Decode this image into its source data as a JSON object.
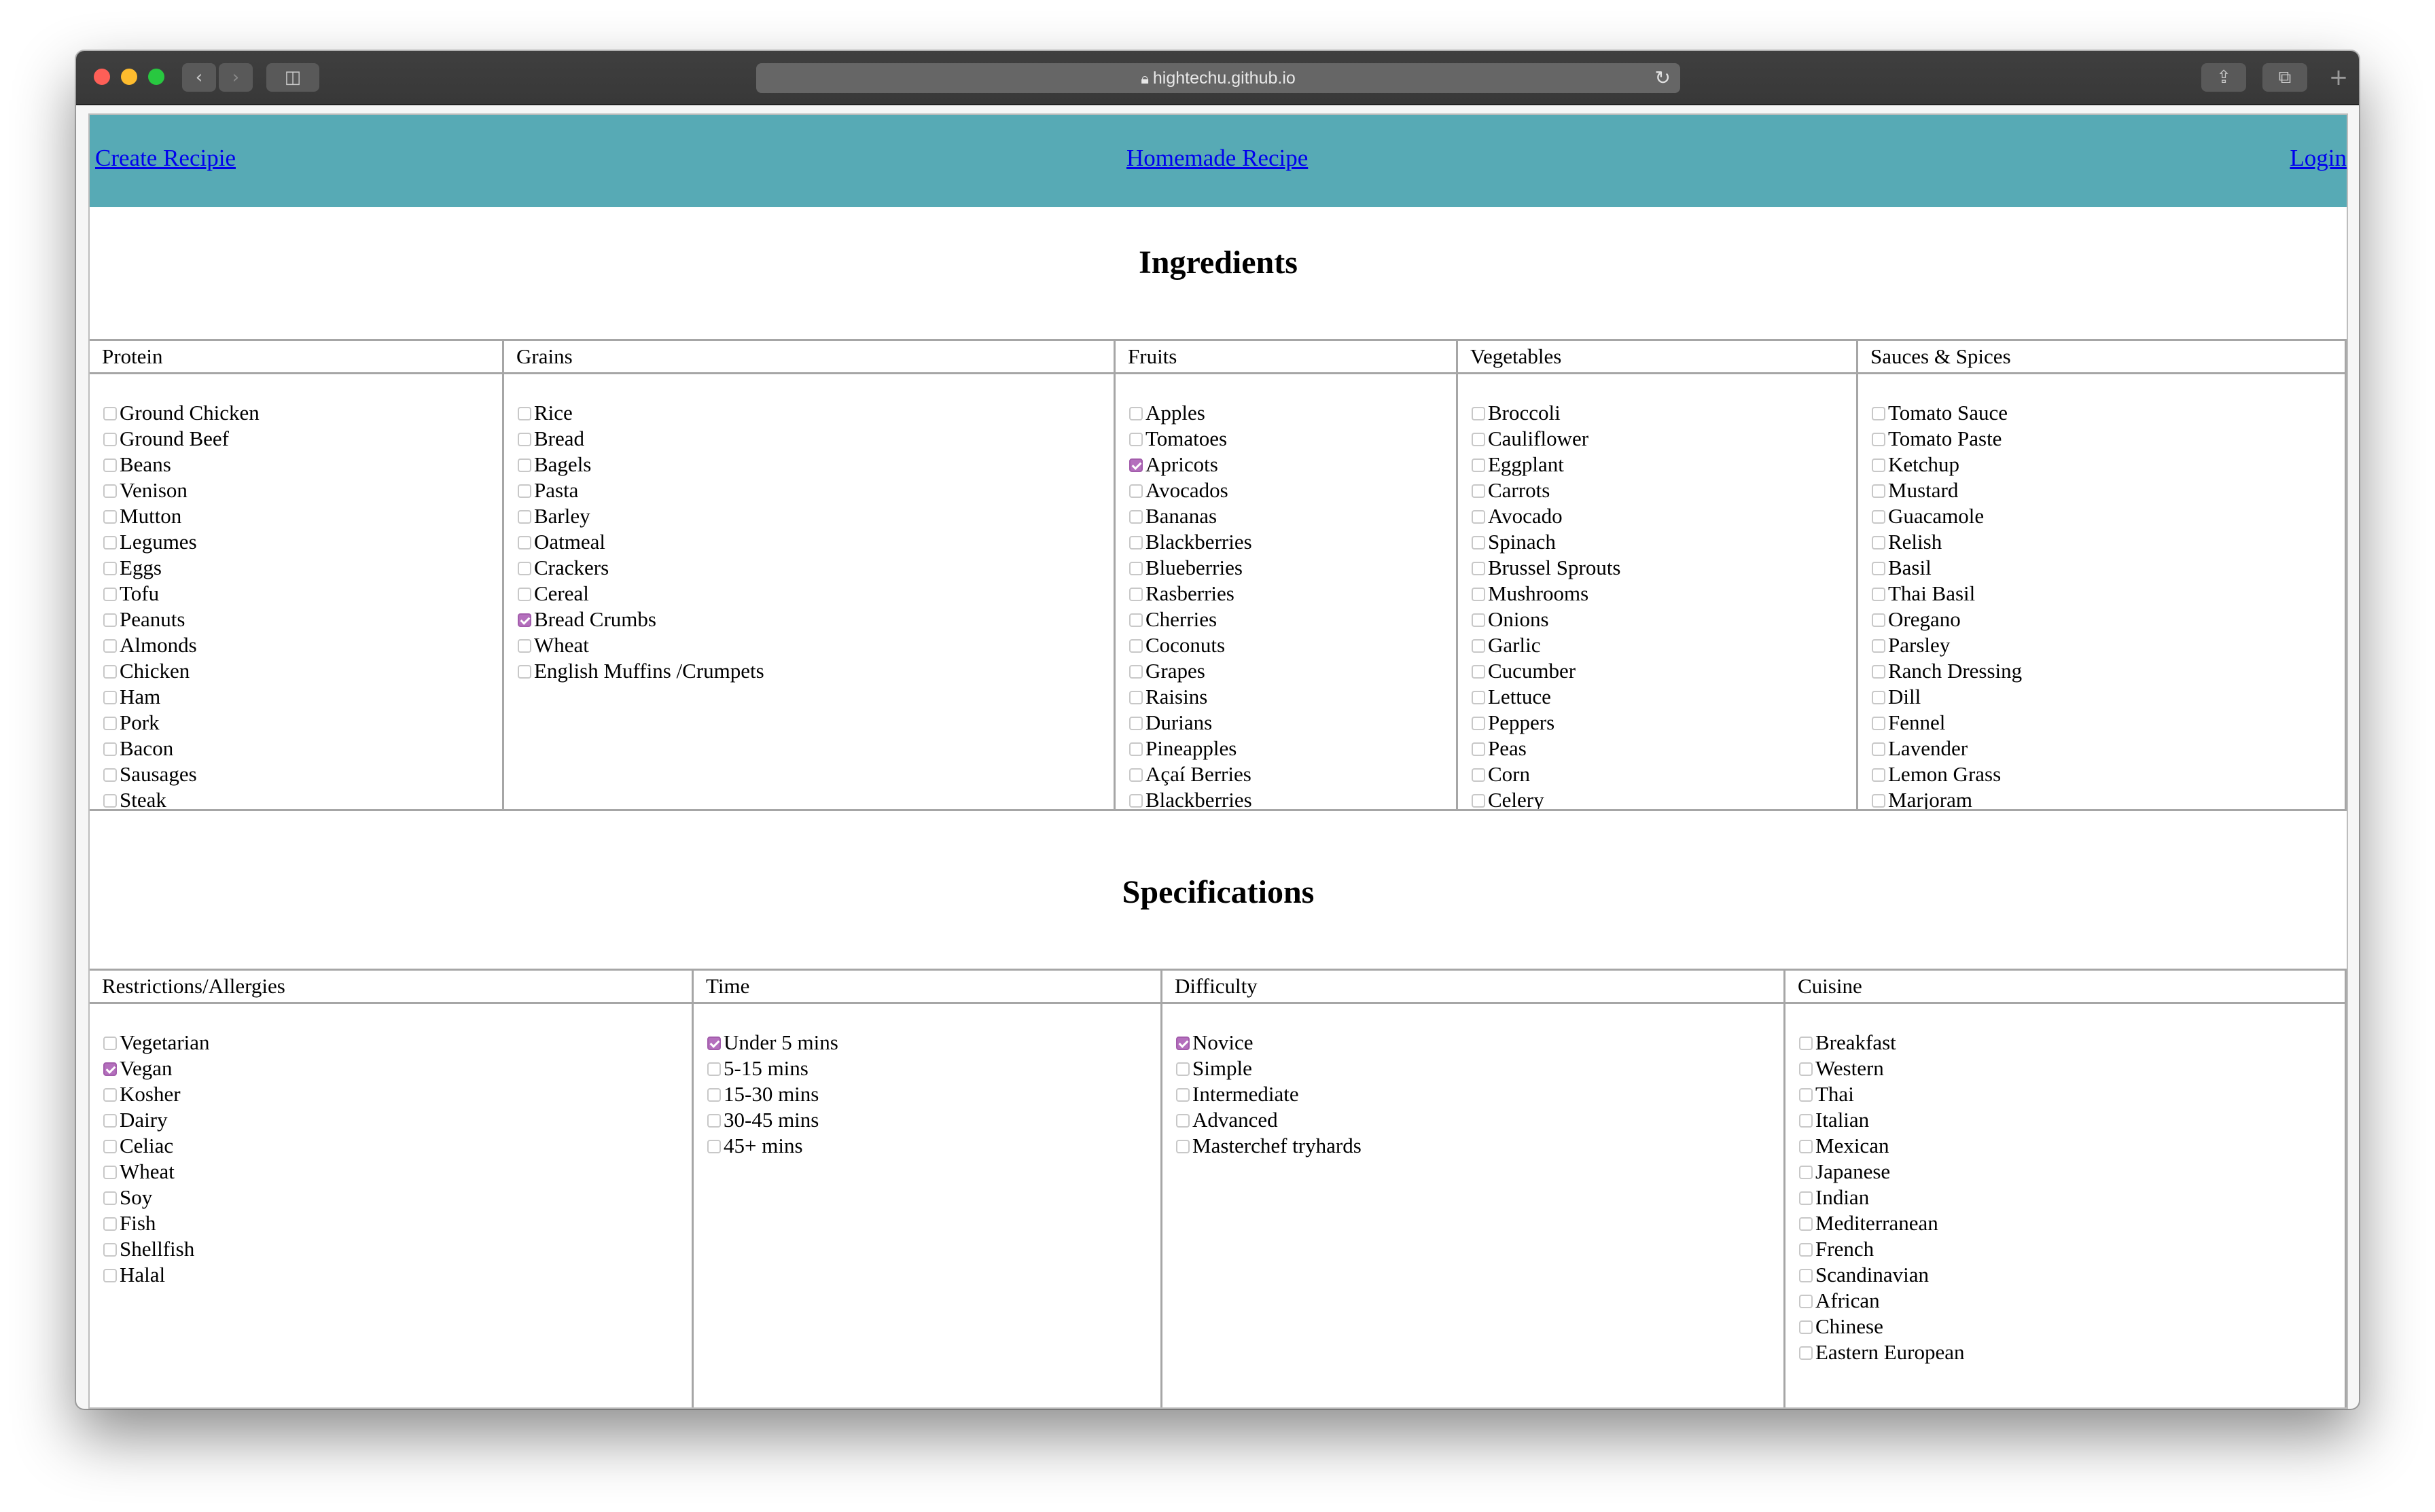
{
  "browser": {
    "url": "hightechu.github.io"
  },
  "nav": {
    "create": "Create Recipie",
    "home": "Homemade Recipe",
    "login": "Login"
  },
  "ingredients": {
    "title": "Ingredients",
    "columns": [
      {
        "header": "Protein",
        "items": [
          {
            "label": "Ground Chicken",
            "checked": false
          },
          {
            "label": "Ground Beef",
            "checked": false
          },
          {
            "label": "Beans",
            "checked": false
          },
          {
            "label": "Venison",
            "checked": false
          },
          {
            "label": "Mutton",
            "checked": false
          },
          {
            "label": "Legumes",
            "checked": false
          },
          {
            "label": "Eggs",
            "checked": false
          },
          {
            "label": "Tofu",
            "checked": false
          },
          {
            "label": "Peanuts",
            "checked": false
          },
          {
            "label": "Almonds",
            "checked": false
          },
          {
            "label": "Chicken",
            "checked": false
          },
          {
            "label": "Ham",
            "checked": false
          },
          {
            "label": "Pork",
            "checked": false
          },
          {
            "label": "Bacon",
            "checked": false
          },
          {
            "label": "Sausages",
            "checked": false
          },
          {
            "label": "Steak",
            "checked": false
          }
        ]
      },
      {
        "header": "Grains",
        "items": [
          {
            "label": "Rice",
            "checked": false
          },
          {
            "label": "Bread",
            "checked": false
          },
          {
            "label": "Bagels",
            "checked": false
          },
          {
            "label": "Pasta",
            "checked": false
          },
          {
            "label": "Barley",
            "checked": false
          },
          {
            "label": "Oatmeal",
            "checked": false
          },
          {
            "label": "Crackers",
            "checked": false
          },
          {
            "label": "Cereal",
            "checked": false
          },
          {
            "label": "Bread Crumbs",
            "checked": true
          },
          {
            "label": "Wheat",
            "checked": false
          },
          {
            "label": "English Muffins /Crumpets",
            "checked": false
          }
        ]
      },
      {
        "header": "Fruits",
        "items": [
          {
            "label": "Apples",
            "checked": false
          },
          {
            "label": "Tomatoes",
            "checked": false
          },
          {
            "label": "Apricots",
            "checked": true
          },
          {
            "label": "Avocados",
            "checked": false
          },
          {
            "label": "Bananas",
            "checked": false
          },
          {
            "label": "Blackberries",
            "checked": false
          },
          {
            "label": "Blueberries",
            "checked": false
          },
          {
            "label": "Rasberries",
            "checked": false
          },
          {
            "label": "Cherries",
            "checked": false
          },
          {
            "label": "Coconuts",
            "checked": false
          },
          {
            "label": "Grapes",
            "checked": false
          },
          {
            "label": "Raisins",
            "checked": false
          },
          {
            "label": "Durians",
            "checked": false
          },
          {
            "label": "Pineapples",
            "checked": false
          },
          {
            "label": "Açaí Berries",
            "checked": false
          },
          {
            "label": "Blackberries",
            "checked": false
          }
        ]
      },
      {
        "header": "Vegetables",
        "items": [
          {
            "label": "Broccoli",
            "checked": false
          },
          {
            "label": "Cauliflower",
            "checked": false
          },
          {
            "label": "Eggplant",
            "checked": false
          },
          {
            "label": "Carrots",
            "checked": false
          },
          {
            "label": "Avocado",
            "checked": false
          },
          {
            "label": "Spinach",
            "checked": false
          },
          {
            "label": "Brussel Sprouts",
            "checked": false
          },
          {
            "label": "Mushrooms",
            "checked": false
          },
          {
            "label": "Onions",
            "checked": false
          },
          {
            "label": "Garlic",
            "checked": false
          },
          {
            "label": "Cucumber",
            "checked": false
          },
          {
            "label": "Lettuce",
            "checked": false
          },
          {
            "label": "Peppers",
            "checked": false
          },
          {
            "label": "Peas",
            "checked": false
          },
          {
            "label": "Corn",
            "checked": false
          },
          {
            "label": "Celery",
            "checked": false
          }
        ]
      },
      {
        "header": "Sauces & Spices",
        "items": [
          {
            "label": "Tomato Sauce",
            "checked": false
          },
          {
            "label": "Tomato Paste",
            "checked": false
          },
          {
            "label": "Ketchup",
            "checked": false
          },
          {
            "label": "Mustard",
            "checked": false
          },
          {
            "label": "Guacamole",
            "checked": false
          },
          {
            "label": "Relish",
            "checked": false
          },
          {
            "label": "Basil",
            "checked": false
          },
          {
            "label": "Thai Basil",
            "checked": false
          },
          {
            "label": "Oregano",
            "checked": false
          },
          {
            "label": "Parsley",
            "checked": false
          },
          {
            "label": "Ranch Dressing",
            "checked": false
          },
          {
            "label": "Dill",
            "checked": false
          },
          {
            "label": "Fennel",
            "checked": false
          },
          {
            "label": "Lavender",
            "checked": false
          },
          {
            "label": "Lemon Grass",
            "checked": false
          },
          {
            "label": "Marjoram",
            "checked": false
          }
        ]
      }
    ]
  },
  "specifications": {
    "title": "Specifications",
    "columns": [
      {
        "header": "Restrictions/Allergies",
        "items": [
          {
            "label": "Vegetarian",
            "checked": false
          },
          {
            "label": "Vegan",
            "checked": true
          },
          {
            "label": "Kosher",
            "checked": false
          },
          {
            "label": "Dairy",
            "checked": false
          },
          {
            "label": "Celiac",
            "checked": false
          },
          {
            "label": "Wheat",
            "checked": false
          },
          {
            "label": "Soy",
            "checked": false
          },
          {
            "label": "Fish",
            "checked": false
          },
          {
            "label": "Shellfish",
            "checked": false
          },
          {
            "label": "Halal",
            "checked": false
          }
        ]
      },
      {
        "header": "Time",
        "items": [
          {
            "label": "Under 5 mins",
            "checked": true
          },
          {
            "label": "5-15 mins",
            "checked": false
          },
          {
            "label": "15-30 mins",
            "checked": false
          },
          {
            "label": "30-45 mins",
            "checked": false
          },
          {
            "label": "45+ mins",
            "checked": false
          }
        ]
      },
      {
        "header": "Difficulty",
        "items": [
          {
            "label": "Novice",
            "checked": true
          },
          {
            "label": "Simple",
            "checked": false
          },
          {
            "label": "Intermediate",
            "checked": false
          },
          {
            "label": "Advanced",
            "checked": false
          },
          {
            "label": "Masterchef tryhards",
            "checked": false
          }
        ]
      },
      {
        "header": "Cuisine",
        "items": [
          {
            "label": "Breakfast",
            "checked": false
          },
          {
            "label": "Western",
            "checked": false
          },
          {
            "label": "Thai",
            "checked": false
          },
          {
            "label": "Italian",
            "checked": false
          },
          {
            "label": "Mexican",
            "checked": false
          },
          {
            "label": "Japanese",
            "checked": false
          },
          {
            "label": "Indian",
            "checked": false
          },
          {
            "label": "Mediterranean",
            "checked": false
          },
          {
            "label": "French",
            "checked": false
          },
          {
            "label": "Scandinavian",
            "checked": false
          },
          {
            "label": "African",
            "checked": false
          },
          {
            "label": "Chinese",
            "checked": false
          },
          {
            "label": "Eastern European",
            "checked": false
          }
        ]
      }
    ]
  },
  "theme": {
    "navbar_color": "#57aab5",
    "checkbox_checked_color": "#b46fbd",
    "link_color": "#0000ee"
  }
}
